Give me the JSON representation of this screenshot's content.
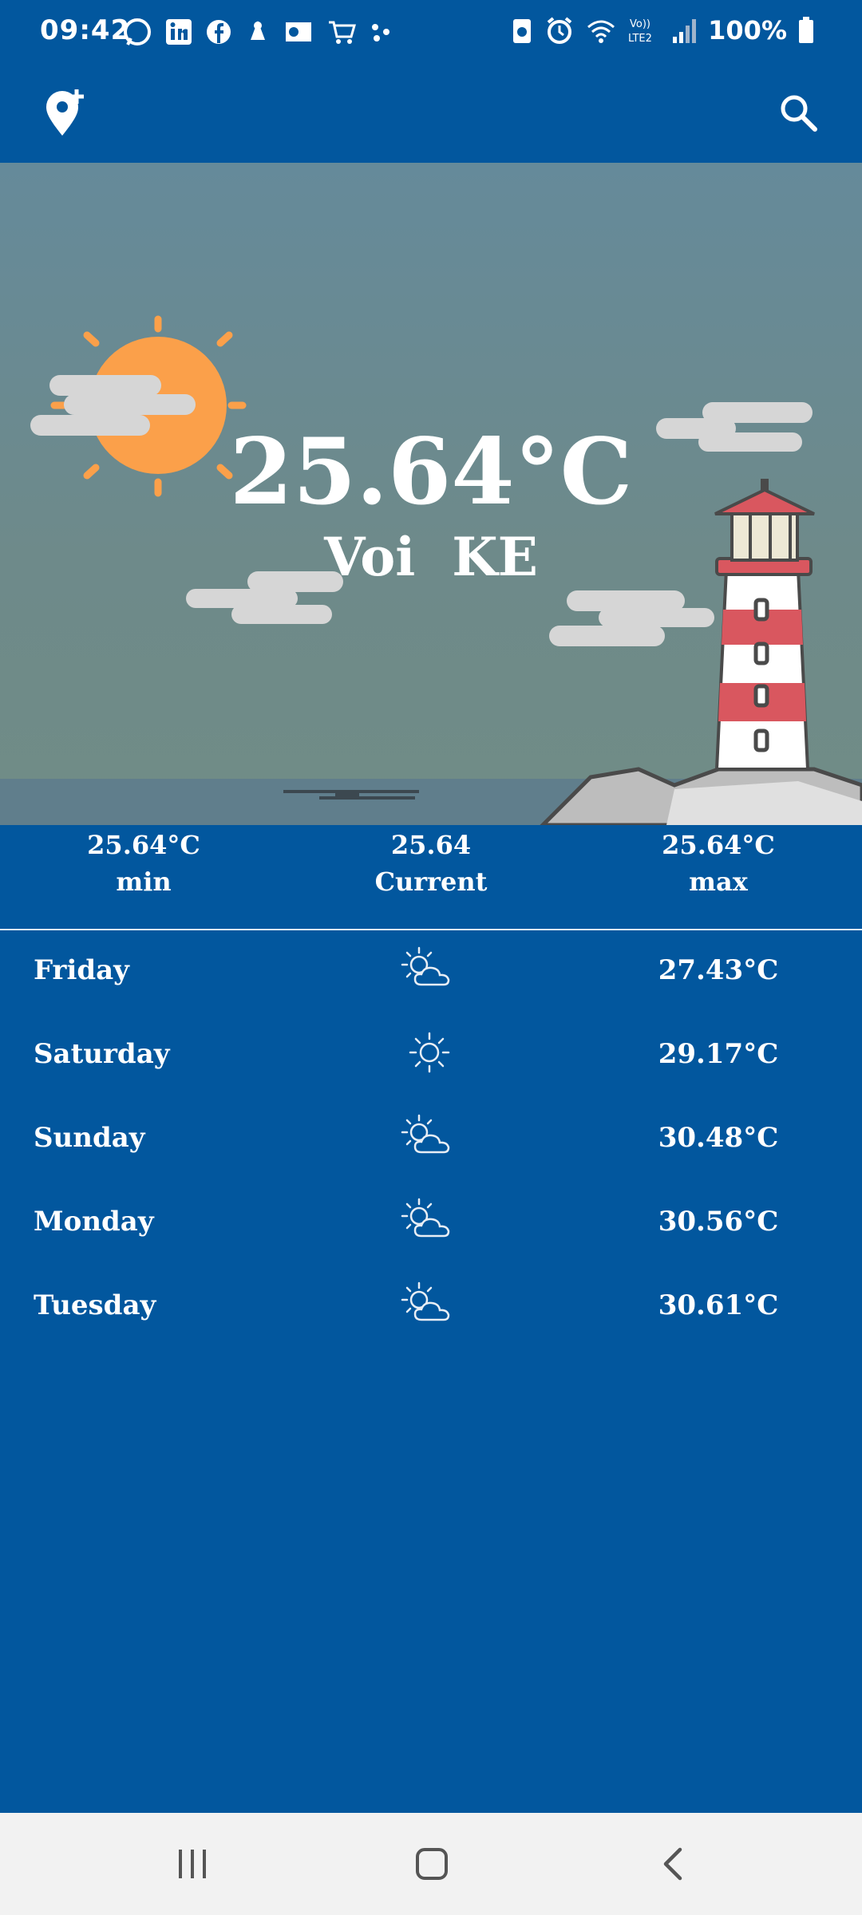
{
  "status_bar": {
    "time": "09:42",
    "battery": "100%",
    "left_icons": [
      "whatsapp-icon",
      "linkedin-icon",
      "facebook-icon",
      "app-icon",
      "outlook-icon",
      "cart-icon",
      "dots-icon"
    ],
    "right_icons": [
      "battery-saver-icon",
      "alarm-icon",
      "wifi-icon",
      "volte-icon",
      "signal-icon",
      "battery-icon"
    ]
  },
  "app_bar": {
    "add_location_icon": "add-location-icon",
    "search_icon": "search-icon"
  },
  "hero": {
    "temperature": "25.64°C",
    "location": "Voi  KE"
  },
  "summary": {
    "min_value": "25.64°C",
    "min_label": "min",
    "current_value": "25.64",
    "current_label": "Current",
    "max_value": "25.64°C",
    "max_label": "max"
  },
  "forecast": [
    {
      "day": "Friday",
      "icon": "partly-cloudy-icon",
      "temp": "27.43°C"
    },
    {
      "day": "Saturday",
      "icon": "sun-icon",
      "temp": "29.17°C"
    },
    {
      "day": "Sunday",
      "icon": "partly-cloudy-icon",
      "temp": "30.48°C"
    },
    {
      "day": "Monday",
      "icon": "partly-cloudy-icon",
      "temp": "30.56°C"
    },
    {
      "day": "Tuesday",
      "icon": "partly-cloudy-icon",
      "temp": "30.61°C"
    }
  ],
  "colors": {
    "primary": "#02579E",
    "sky": "#658A9A",
    "sun": "#FBA04A",
    "lighthouse_red": "#D9575F"
  }
}
